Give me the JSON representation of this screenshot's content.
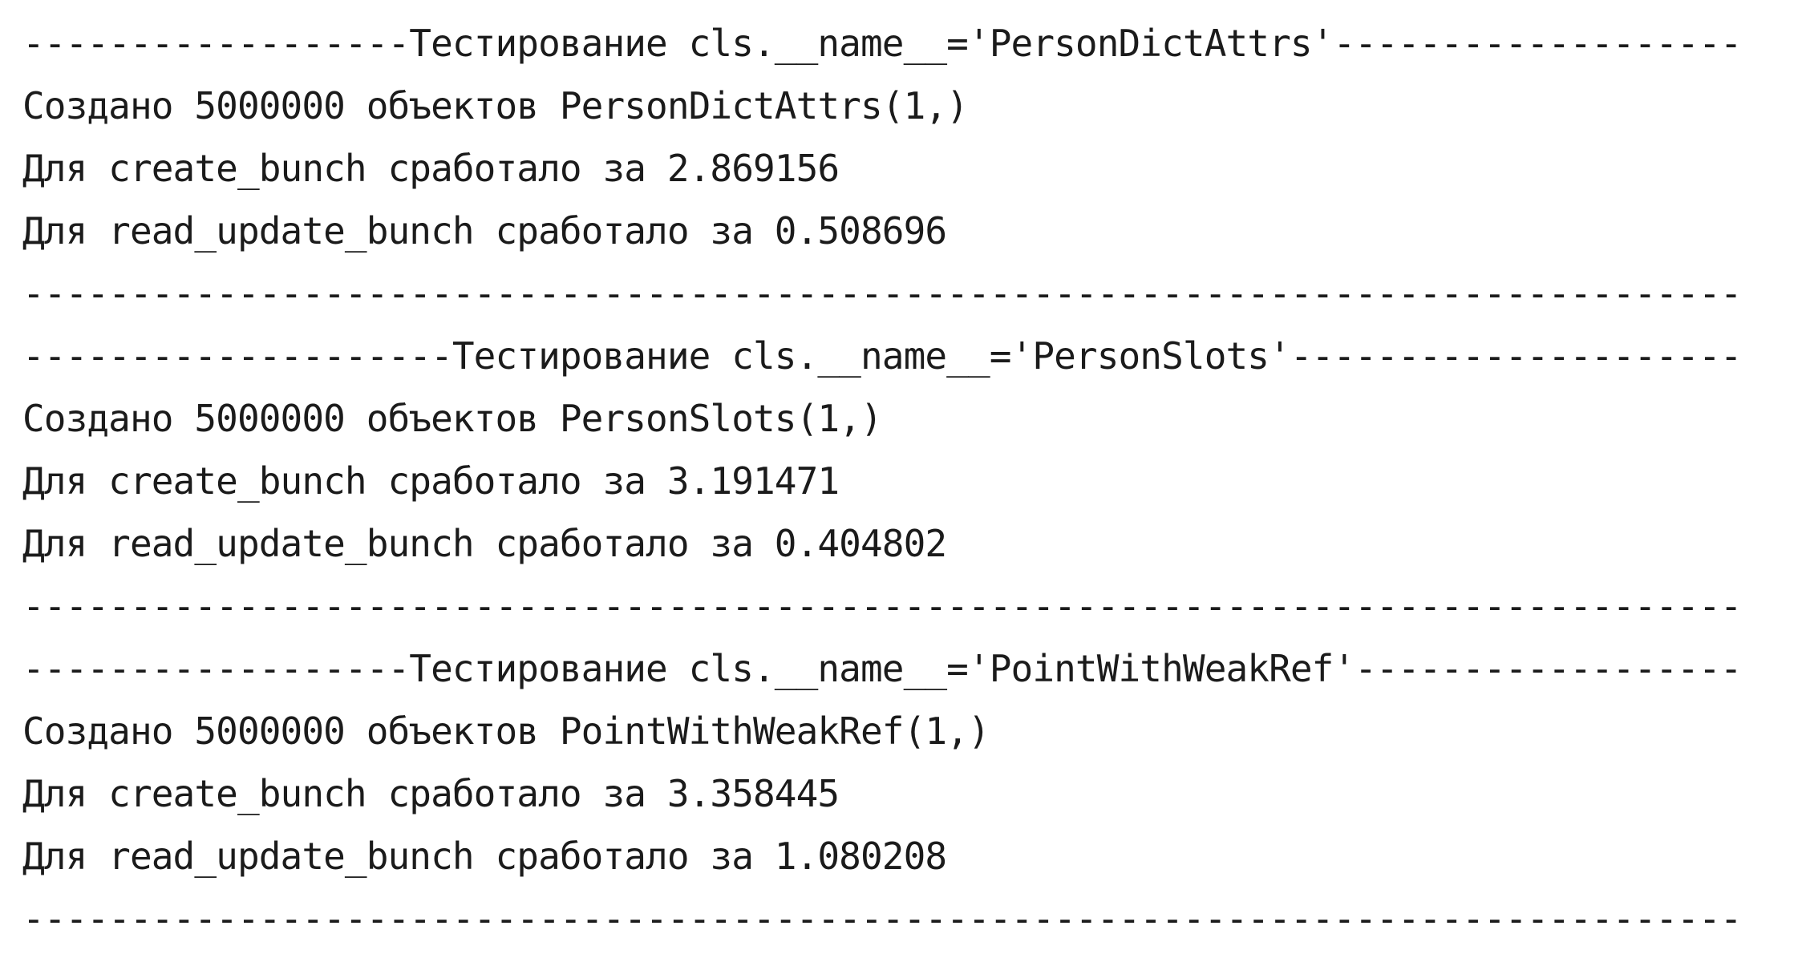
{
  "console": {
    "lines": [
      "------------------Тестирование cls.__name__='PersonDictAttrs'-------------------",
      "Создано 5000000 объектов PersonDictAttrs(1,)",
      "Для create_bunch сработало за 2.869156",
      "Для read_update_bunch сработало за 0.508696",
      "--------------------------------------------------------------------------------",
      "--------------------Тестирование cls.__name__='PersonSlots'---------------------",
      "Создано 5000000 объектов PersonSlots(1,)",
      "Для create_bunch сработало за 3.191471",
      "Для read_update_bunch сработало за 0.404802",
      "--------------------------------------------------------------------------------",
      "------------------Тестирование cls.__name__='PointWithWeakRef'------------------",
      "Создано 5000000 объектов PointWithWeakRef(1,)",
      "Для create_bunch сработало за 3.358445",
      "Для read_update_bunch сработало за 1.080208",
      "--------------------------------------------------------------------------------"
    ]
  }
}
